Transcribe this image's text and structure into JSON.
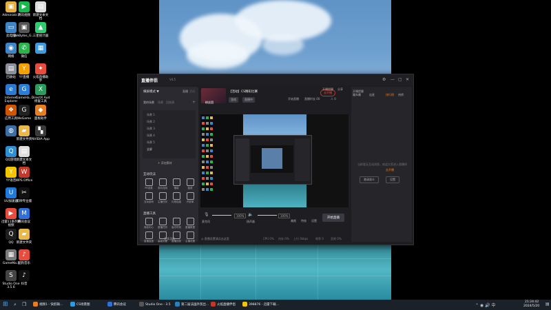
{
  "desktop": {
    "icons_col1": [
      {
        "label": "Administr...",
        "color": "#e6b040",
        "sym": "▣"
      },
      {
        "label": "此电脑",
        "color": "#3f86c9",
        "sym": "▭"
      },
      {
        "label": "网络",
        "color": "#3f86c9",
        "sym": "◉"
      },
      {
        "label": "回收站",
        "color": "#8a8f99",
        "sym": "▤"
      },
      {
        "label": "Internet\nExplorer",
        "color": "#2b79d0",
        "sym": "e"
      },
      {
        "label": "应用工具",
        "color": "#d35400",
        "sym": "❖"
      },
      {
        "label": "",
        "color": "#3a6ea5",
        "sym": "◍"
      },
      {
        "label": "QQ游戏",
        "color": "#2d8fd5",
        "sym": "Q"
      },
      {
        "label": "YY语音",
        "color": "#f5c400",
        "sym": "Y"
      },
      {
        "label": "UU加速器",
        "color": "#1f7ad9",
        "sym": "U"
      },
      {
        "label": "迅雷11系列的\n视频",
        "color": "#e74c3c",
        "sym": "▶"
      },
      {
        "label": "QQ",
        "color": "#1e1e1e",
        "sym": "Q"
      },
      {
        "label": "GameMa...",
        "color": "#7a7a7a",
        "sym": "▦"
      },
      {
        "label": "Studio One\n3.5.6",
        "color": "#444",
        "sym": "S"
      }
    ],
    "icons_col2": [
      {
        "label": "腾讯视频",
        "color": "#1ab84f",
        "sym": "▶"
      },
      {
        "label": "WeBytes_G...",
        "color": "#555",
        "sym": "▣"
      },
      {
        "label": "微信",
        "color": "#2bb24c",
        "sym": "✆"
      },
      {
        "label": "YY直播",
        "color": "#f0a000",
        "sym": "Y"
      },
      {
        "label": "GameHa...",
        "color": "#2d7dd2",
        "sym": "G"
      },
      {
        "label": "WeGame",
        "color": "#222",
        "sym": "G"
      },
      {
        "label": "新建文件夹",
        "color": "#e8b84a",
        "sym": "▰"
      },
      {
        "label": "新建文本文\n档",
        "color": "#ddd",
        "sym": "▤"
      },
      {
        "label": "WPS Office",
        "color": "#c0392b",
        "sym": "W"
      },
      {
        "label": "剪映专业版",
        "color": "#111",
        "sym": "✂"
      },
      {
        "label": "腾讯会议",
        "color": "#2f6fd6",
        "sym": "M"
      },
      {
        "label": "新建文件夹",
        "color": "#e8b84a",
        "sym": "▰"
      },
      {
        "label": "酷狗音乐",
        "color": "#e74c3c",
        "sym": "♪"
      },
      {
        "label": "抖音",
        "color": "#111",
        "sym": "♪"
      }
    ],
    "icons_col3": [
      {
        "label": "新建文本文\n档",
        "color": "#ddd",
        "sym": "▤"
      },
      {
        "label": "三星统计器",
        "color": "#2ecc71",
        "sym": "▲"
      },
      {
        "label": "",
        "color": "#3a9be0",
        "sym": "▦"
      },
      {
        "label": "火焰直播助\n手",
        "color": "#e74c3c",
        "sym": "✦"
      },
      {
        "label": "DirectX Aud\n修复工具",
        "color": "#2c9c5c",
        "sym": "X"
      },
      {
        "label": "面板助手",
        "color": "#e67e22",
        "sym": "◆"
      },
      {
        "label": "NVIDIA App",
        "color": "#3a3a3a",
        "sym": "▚"
      }
    ]
  },
  "app": {
    "logo": "直播伴侣",
    "version": "V4.5",
    "header_room_title": "【活动】CS精彩比赛",
    "header_tags": [
      "游戏",
      "直播中"
    ],
    "user_label": "粉丝团",
    "live_btn": "去开播",
    "top_right": [
      "开播提醒",
      "分享"
    ],
    "left": {
      "mode": "横屏模式 ▼",
      "tabs": [
        "直播",
        "活动"
      ],
      "scene_header": "我的场景",
      "scene_tabs": [
        "场景",
        "回放源"
      ],
      "scenes": [
        "场景 1",
        "场景 2",
        "场景 3",
        "场景 4",
        "场景 5",
        "全屏"
      ],
      "add_scene": "+ 添加素材",
      "interact_title": "互动玩法",
      "interact_tools": [
        "PK连麦",
        "观众连线",
        "福袋",
        "抽奖",
        "互动游戏",
        "主播任务",
        "礼物连接",
        "许愿单"
      ],
      "anchor_title": "直播工具",
      "anchor_tools": [
        "商品中心",
        "直播任务",
        "高光时刻",
        "直播数据",
        "直播复盘",
        "高级设置",
        "直播回放",
        "主播设置"
      ],
      "more_tools": "··· 更多功能"
    },
    "center": {
      "info": [
        "开始直播",
        "直播时长 00",
        "人 0"
      ],
      "mic_label": "麦克风",
      "mic_value": "100%",
      "speaker_label": "扬声器",
      "speaker_value": "100%",
      "bottom_icons": [
        "美颜",
        "特效",
        "设置"
      ],
      "start_live": "开始直播",
      "status_bar": [
        "CPU 0%",
        "内存 0%",
        "上行 0kbps",
        "帧率 0",
        "丢帧 0%"
      ],
      "status_left": "◎ 直播设置请点击这里"
    },
    "right": {
      "tabs": [
        "观众席",
        "连麦",
        "排行榜",
        "热榜"
      ],
      "empty_text": "当前暂无互动消息，欢迎大家进入直播间",
      "empty_link": "去开播",
      "buttons": [
        "邀请观众",
        "设置"
      ]
    }
  },
  "taskbar": {
    "items": [
      {
        "label": "视频1 - 快剪辑...",
        "color": "#e67e22"
      },
      {
        "label": "CS场景图",
        "color": "#3498db"
      },
      {
        "label": "腾讯会议",
        "color": "#2f6fd6"
      },
      {
        "label": "Studio One - 3.5",
        "color": "#555"
      },
      {
        "label": "第二届法国外贸出...",
        "color": "#2980b9"
      },
      {
        "label": "火焰直播伴侣",
        "color": "#c0392b"
      },
      {
        "label": "398876 - 迅雷下载...",
        "color": "#f1c40f"
      }
    ],
    "time": "21:24:42",
    "date": "2024/5/20"
  }
}
